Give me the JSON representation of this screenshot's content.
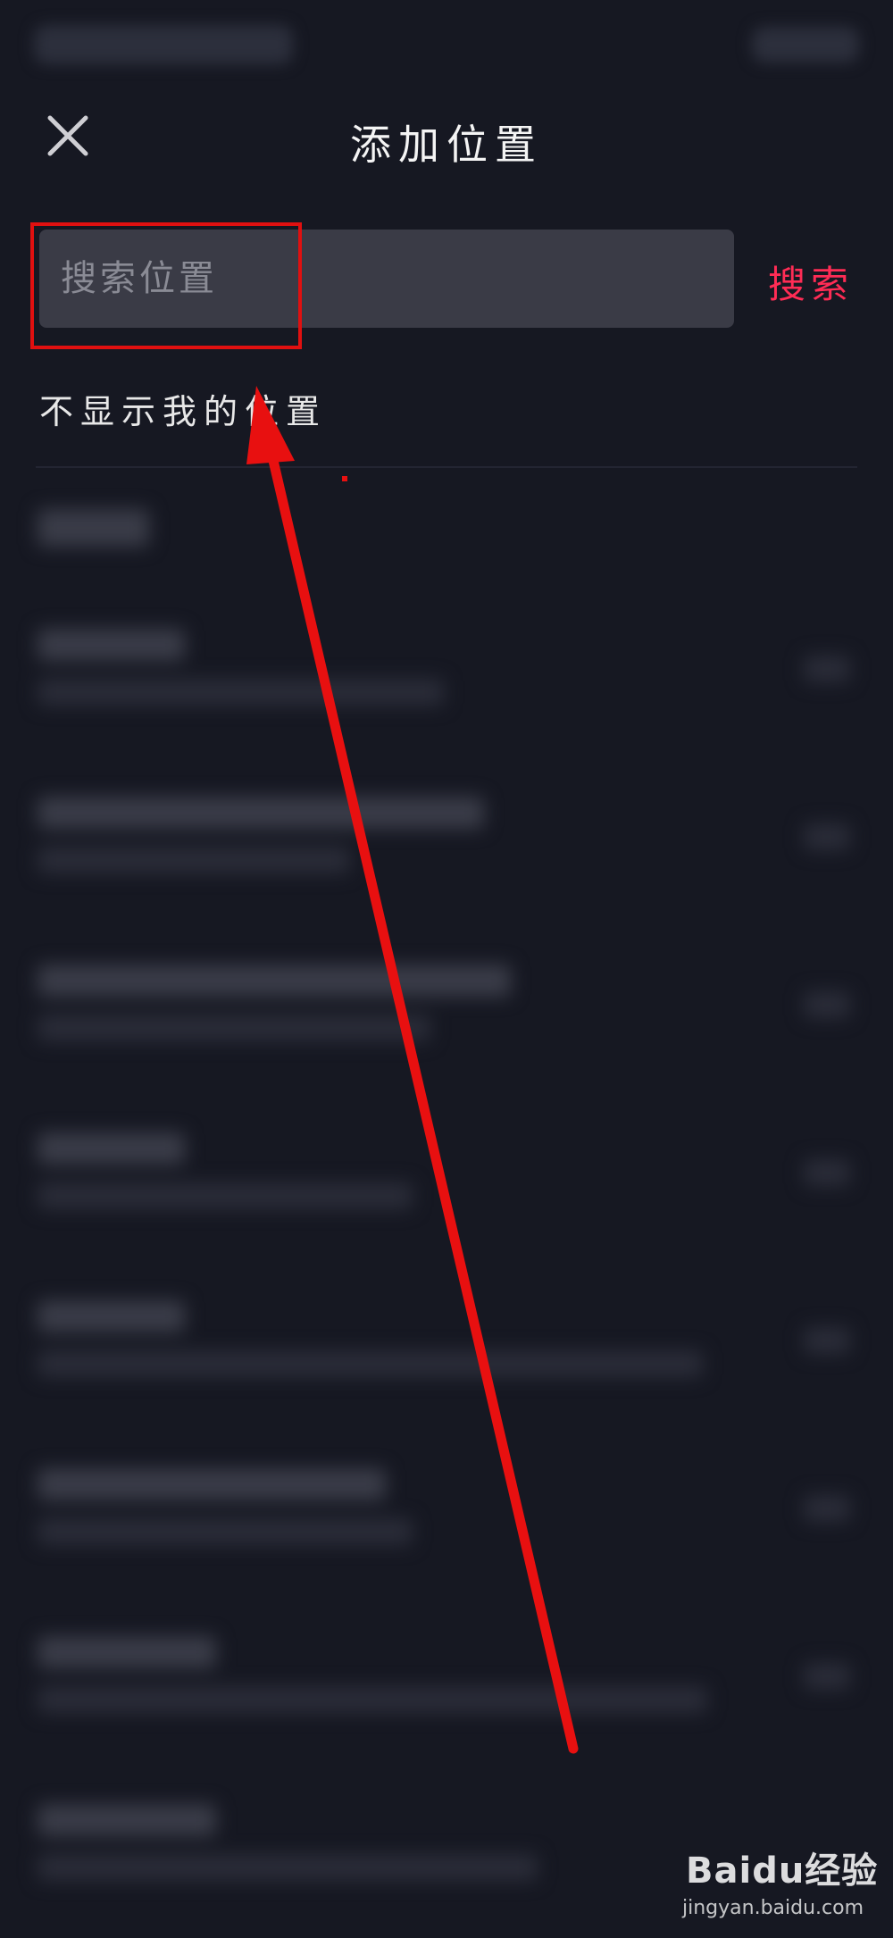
{
  "header": {
    "title": "添加位置",
    "close_icon": "close-icon"
  },
  "search": {
    "placeholder": "搜索位置",
    "button_label": "搜索"
  },
  "options": {
    "hide_location_label": "不显示我的位置"
  },
  "colors": {
    "background": "#161822",
    "input_background": "#3a3b46",
    "accent": "#ff2c55",
    "annotation": "#e01010"
  },
  "watermark": {
    "logo_text": "Baidu经验",
    "url_text": "jingyan.baidu.com"
  }
}
